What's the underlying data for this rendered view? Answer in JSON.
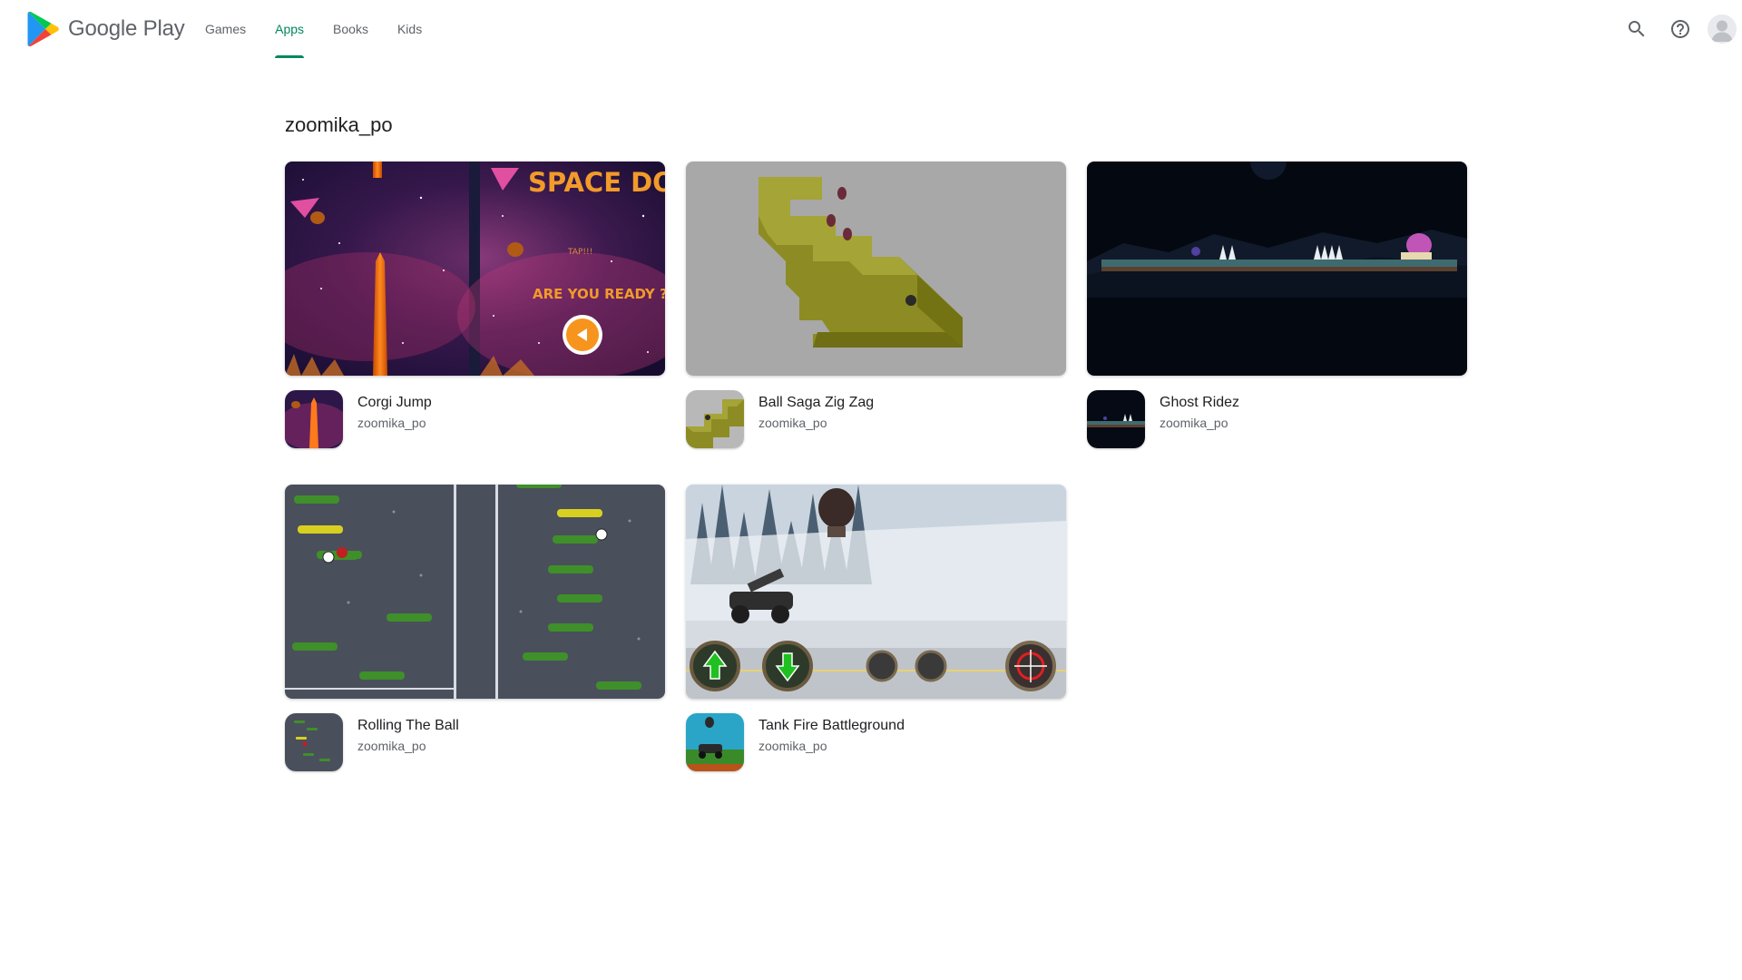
{
  "header": {
    "brand": "Google Play",
    "nav": [
      {
        "label": "Games",
        "active": false
      },
      {
        "label": "Apps",
        "active": true
      },
      {
        "label": "Books",
        "active": false
      },
      {
        "label": "Kids",
        "active": false
      }
    ],
    "icons": [
      "search-icon",
      "help-icon",
      "account-avatar"
    ],
    "accent_color": "#01875f"
  },
  "page": {
    "title": "zoomika_po"
  },
  "apps": [
    {
      "name": "Corgi Jump",
      "developer": "zoomika_po",
      "screenshot_text": [
        "SPACE DOG",
        "TAP!!!",
        "ARE YOU READY ?"
      ]
    },
    {
      "name": "Ball Saga Zig Zag",
      "developer": "zoomika_po"
    },
    {
      "name": "Ghost Ridez",
      "developer": "zoomika_po"
    },
    {
      "name": "Rolling The Ball",
      "developer": "zoomika_po"
    },
    {
      "name": "Tank Fire Battleground",
      "developer": "zoomika_po"
    }
  ]
}
